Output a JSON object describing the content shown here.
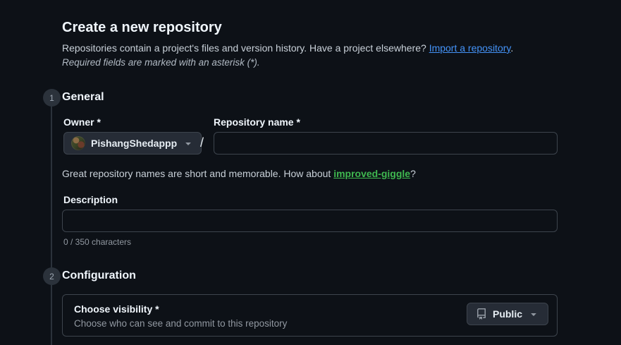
{
  "header": {
    "title": "Create a new repository",
    "intro_text": "Repositories contain a project's files and version history. Have a project elsewhere? ",
    "import_link": "Import a repository",
    "intro_period": ".",
    "required_note": "Required fields are marked with an asterisk (*)."
  },
  "general": {
    "step_number": "1",
    "heading": "General",
    "owner_label": "Owner *",
    "owner_value": "PishangShedappp",
    "separator": "/",
    "repo_name_label": "Repository name *",
    "repo_name_value": "",
    "suggestion_prefix": "Great repository names are short and memorable. How about ",
    "suggestion_name": "improved-giggle",
    "suggestion_suffix": "?",
    "description_label": "Description",
    "description_value": "",
    "char_count": "0 / 350 characters"
  },
  "configuration": {
    "step_number": "2",
    "heading": "Configuration",
    "visibility_label": "Choose visibility *",
    "visibility_help": "Choose who can see and commit to this repository",
    "visibility_value": "Public"
  },
  "colors": {
    "background": "#0d1117",
    "border": "#3d444d",
    "text_primary": "#f0f6fc",
    "text_muted": "#9198a1",
    "link_blue": "#4493f8",
    "suggestion_green": "#3fb950",
    "button_bg": "#262c36"
  }
}
